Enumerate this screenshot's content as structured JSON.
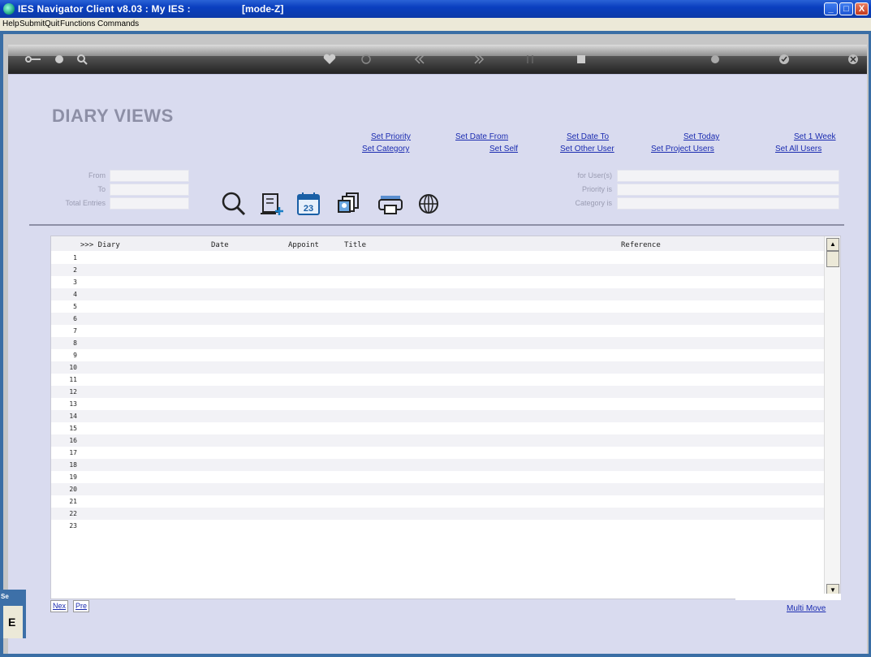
{
  "window": {
    "title": "IES Navigator Client v8.03 : My IES :",
    "mode": "[mode-Z]",
    "controls": [
      "_",
      "□",
      "X"
    ]
  },
  "menu": [
    "Help",
    "Submit",
    "Quit",
    "Functions",
    "Commands"
  ],
  "page": {
    "title": "DIARY VIEWS"
  },
  "links": {
    "set_priority": "Set Priority",
    "set_date_from": "Set Date From",
    "set_date_to": "Set Date To",
    "set_today": "Set Today",
    "set_1_week": "Set 1 Week",
    "set_category": "Set Category",
    "set_self": "Set Self",
    "set_other_user": "Set Other User",
    "set_project_users": "Set Project Users",
    "set_all_users": "Set All Users",
    "multi_move": "Multi Move"
  },
  "filters": {
    "from_label": "From",
    "to_label": "To",
    "total_entries_label": "Total Entries",
    "for_users_label": "for User(s)",
    "priority_label": "Priority is",
    "category_label": "Category is"
  },
  "calendar_icon_day": "23",
  "grid": {
    "columns": [
      ">>> Diary",
      "Date",
      "Appoint",
      "Title",
      "Reference"
    ],
    "row_numbers": [
      "1",
      "2",
      "3",
      "4",
      "5",
      "6",
      "7",
      "8",
      "9",
      "10",
      "11",
      "12",
      "13",
      "14",
      "15",
      "16",
      "17",
      "18",
      "19",
      "20",
      "21",
      "22",
      "23"
    ]
  },
  "nav": {
    "next": "Nex",
    "prev": "Pre"
  },
  "side_tab": {
    "label": "Se",
    "letter": "E"
  }
}
